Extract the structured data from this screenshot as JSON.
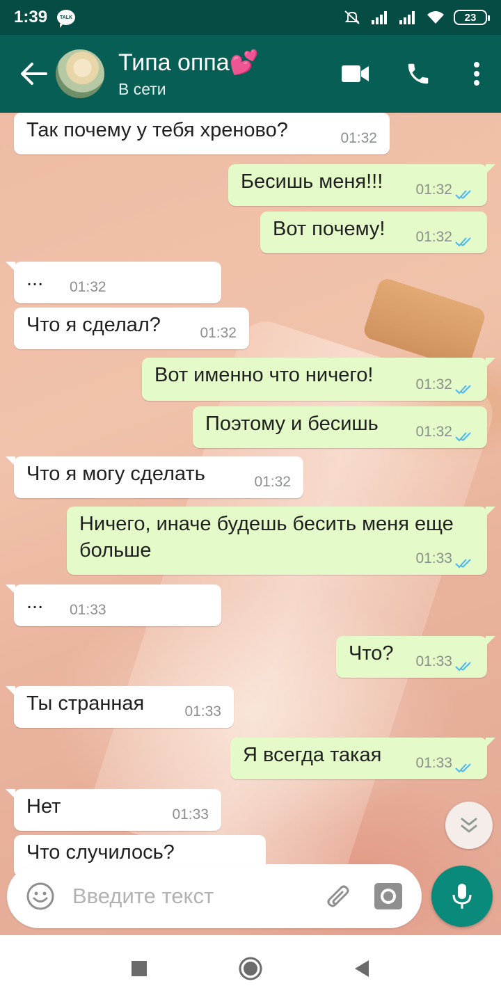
{
  "status_bar": {
    "time": "1:39",
    "talk_badge": "TALK",
    "battery": "23",
    "icons": [
      "talk-icon",
      "mute-icon",
      "signal-icon",
      "signal-icon",
      "wifi-icon",
      "battery-icon"
    ]
  },
  "header": {
    "contact_name": "Типа оппа💕",
    "contact_status": "В сети",
    "icons": [
      "back-arrow-icon",
      "video-camera-icon",
      "phone-icon",
      "more-vert-icon"
    ]
  },
  "messages": [
    {
      "dir": "in",
      "text": "Так почему у тебя хреново?",
      "time": "01:32"
    },
    {
      "dir": "out",
      "text": "Бесишь меня!!!",
      "time": "01:32",
      "read": true
    },
    {
      "dir": "out",
      "text": "Вот почему!",
      "time": "01:32",
      "read": true
    },
    {
      "dir": "in",
      "text": "...",
      "time": "01:32"
    },
    {
      "dir": "in",
      "text": "Что я сделал?",
      "time": "01:32"
    },
    {
      "dir": "out",
      "text": "Вот именно что ничего!",
      "time": "01:32",
      "read": true
    },
    {
      "dir": "out",
      "text": "Поэтому и бесишь",
      "time": "01:32",
      "read": true
    },
    {
      "dir": "in",
      "text": "Что я могу сделать",
      "time": "01:32"
    },
    {
      "dir": "out",
      "text": "Ничего, иначе будешь бесить меня еще больше",
      "time": "01:33",
      "read": true
    },
    {
      "dir": "in",
      "text": "...",
      "time": "01:33"
    },
    {
      "dir": "out",
      "text": "Что?",
      "time": "01:33",
      "read": true
    },
    {
      "dir": "in",
      "text": "Ты странная",
      "time": "01:33"
    },
    {
      "dir": "out",
      "text": "Я всегда такая",
      "time": "01:33",
      "read": true
    },
    {
      "dir": "in",
      "text": "Нет",
      "time": "01:33"
    },
    {
      "dir": "in",
      "text": "Что случилось?",
      "time": ""
    }
  ],
  "composer": {
    "placeholder": "Введите текст",
    "icons": [
      "emoji-icon",
      "paperclip-icon",
      "camera-icon",
      "microphone-icon"
    ]
  },
  "nav_bar": {
    "icons": [
      "recents-square-icon",
      "home-circle-icon",
      "back-triangle-icon"
    ]
  },
  "colors": {
    "header": "#075e54",
    "status_bar": "#054d44",
    "incoming_bubble": "#ffffff",
    "outgoing_bubble": "#e4fbc9",
    "read_ticks": "#4fb6ec",
    "mic_button": "#0a8a7a"
  }
}
